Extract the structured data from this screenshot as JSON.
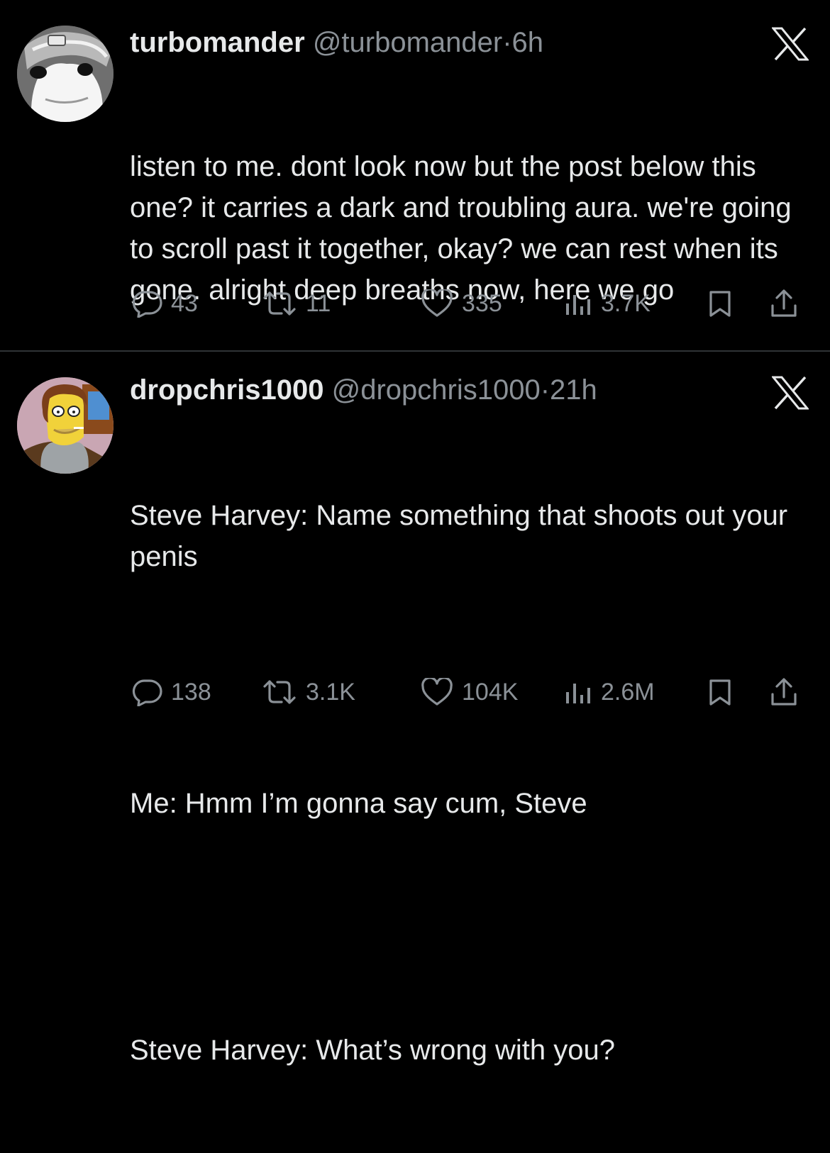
{
  "posts": [
    {
      "display_name": "turbomander",
      "handle": "@turbomander",
      "separator": "·",
      "time": "6h",
      "paragraphs": [
        "listen to me. dont look now but the post below this one? it carries a dark and troubling aura. we're going to scroll past it together, okay? we can rest when its gone. alright deep breaths now, here we go"
      ],
      "replies": "43",
      "reposts": "11",
      "likes": "335",
      "views": "3.7K",
      "icons": {
        "reply": "reply-icon",
        "repost": "repost-icon",
        "like": "heart-icon",
        "views": "views-icon",
        "bookmark": "bookmark-icon",
        "share": "share-icon",
        "platform": "x-logo-icon"
      }
    },
    {
      "display_name": "dropchris1000",
      "handle": "@dropchris1000",
      "separator": "·",
      "time": "21h",
      "paragraphs": [
        "Steve Harvey: Name something that shoots out your penis",
        "Me: Hmm I’m gonna say cum, Steve",
        "Steve Harvey: What’s wrong with you?"
      ],
      "replies": "138",
      "reposts": "3.1K",
      "likes": "104K",
      "views": "2.6M",
      "icons": {
        "reply": "reply-icon",
        "repost": "repost-icon",
        "like": "heart-icon",
        "views": "views-icon",
        "bookmark": "bookmark-icon",
        "share": "share-icon",
        "platform": "x-logo-icon"
      }
    }
  ],
  "colors": {
    "background": "#000000",
    "primary_text": "#e7e9ea",
    "secondary_text": "#8b9197",
    "divider": "#2f3336"
  }
}
